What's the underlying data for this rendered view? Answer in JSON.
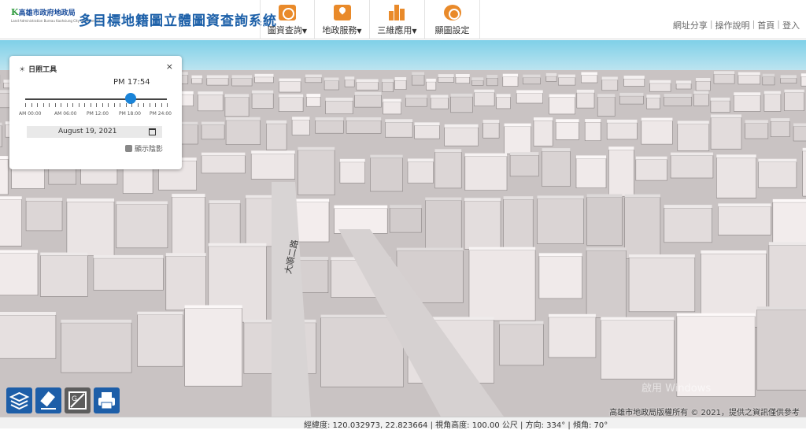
{
  "header": {
    "logo_line1": "高雄市政府地政局",
    "logo_line2": "Land Administration Bureau Kaohsiung City Government",
    "title": "多目標地籍圖立體圖資查詢系統"
  },
  "nav": [
    {
      "label": "圖資查詢",
      "icon": "map-search-icon"
    },
    {
      "label": "地政服務",
      "icon": "land-service-icon"
    },
    {
      "label": "三維應用",
      "icon": "buildings-3d-icon"
    },
    {
      "label": "顯圖設定",
      "icon": "display-settings-icon"
    }
  ],
  "top_links": [
    "網址分享",
    "操作說明",
    "首頁",
    "登入"
  ],
  "sun_tool": {
    "title": "日照工具",
    "current_time": "PM 17:54",
    "slider_fraction": 0.745,
    "tick_labels": [
      "AM 00:00",
      "AM 06:00",
      "PM 12:00",
      "PM 18:00",
      "PM 24:00"
    ],
    "date": "August 19, 2021",
    "shadow_label": "顯示陰影"
  },
  "map": {
    "road_label": "大順二路",
    "copyright": "高雄市地政局版權所有 © 2021，提供之資訊僅供參考",
    "watermark": "啟用 Windows"
  },
  "status": {
    "coords": "經緯度: 120.032973, 22.823664 | 視角高度: 100.00 公尺 | 方向: 334° | 傾角: 70°"
  },
  "colors": {
    "accent_orange": "#e98a2a",
    "title_blue": "#1b5fa8",
    "slider_blue": "#1a84d8",
    "tool_button_blue": "#1d5ea8"
  }
}
